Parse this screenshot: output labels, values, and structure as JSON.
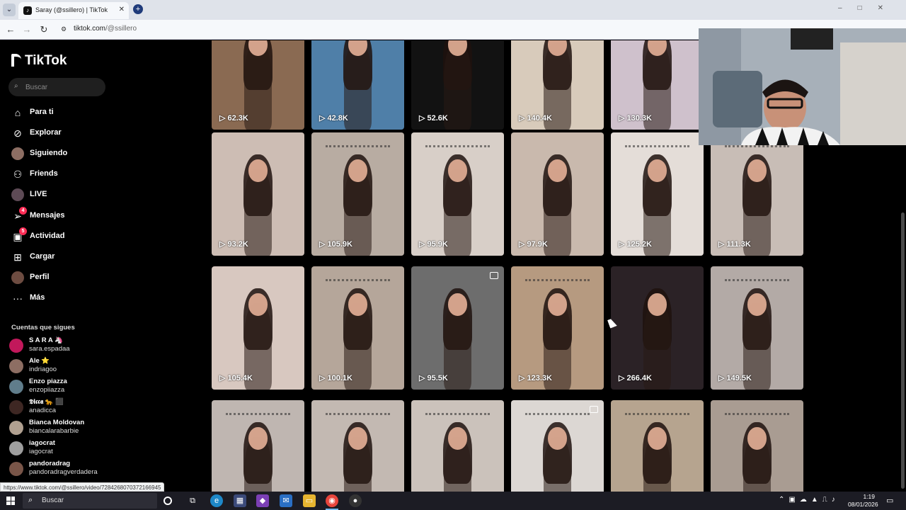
{
  "browser": {
    "tab_title": "Saray (@ssillero) | TikTok",
    "url_host": "tiktok.com",
    "url_path": "/@ssillero",
    "status_url": "https://www.tiktok.com/@ssillero/video/7284268070372166945"
  },
  "sidebar": {
    "logo": "TikTok",
    "search_placeholder": "Buscar",
    "nav": [
      {
        "label": "Para ti",
        "icon": "home-icon"
      },
      {
        "label": "Explorar",
        "icon": "compass-icon"
      },
      {
        "label": "Siguiendo",
        "icon": "avatar-icon"
      },
      {
        "label": "Friends",
        "icon": "friends-icon"
      },
      {
        "label": "LIVE",
        "icon": "live-icon"
      },
      {
        "label": "Mensajes",
        "icon": "send-icon",
        "badge": "4"
      },
      {
        "label": "Actividad",
        "icon": "inbox-icon",
        "badge": "5"
      },
      {
        "label": "Cargar",
        "icon": "upload-icon"
      },
      {
        "label": "Perfil",
        "icon": "profile-icon"
      },
      {
        "label": "Más",
        "icon": "more-icon"
      }
    ],
    "following_title": "Cuentas que sigues",
    "following": [
      {
        "name": "S A R A 🦄",
        "handle": "sara.espadaa",
        "color": "#c2185b"
      },
      {
        "name": "Ale ⭐",
        "handle": "indriagoo",
        "color": "#8d6e63"
      },
      {
        "name": "Enzo piazza",
        "handle": "enzopiiazza",
        "color": "#607d8b"
      },
      {
        "name": "𝕯𝖎𝖈𝖈𝖆 🐆 ⬛",
        "handle": "anadicca",
        "color": "#3e2723"
      },
      {
        "name": "Bianca Moldovan",
        "handle": "biancalarabarbie",
        "color": "#b0a090"
      },
      {
        "name": "iagocrat",
        "handle": "iagocrat",
        "color": "#9e9e9e"
      },
      {
        "name": "pandoradrag",
        "handle": "pandoradragverdadera",
        "color": "#795548"
      }
    ]
  },
  "videos": [
    {
      "views": "62.3K",
      "bg": "#8a6a52",
      "caption": false
    },
    {
      "views": "42.8K",
      "bg": "#4f7fa8",
      "caption": true
    },
    {
      "views": "52.6K",
      "bg": "#121212",
      "caption": true
    },
    {
      "views": "140.4K",
      "bg": "#d8cbbb",
      "caption": false
    },
    {
      "views": "130.3K",
      "bg": "#cfc1cc",
      "caption": false
    },
    {
      "views": "93.2K",
      "bg": "#cdbdb4",
      "caption": false
    },
    {
      "views": "105.9K",
      "bg": "#b8aca2",
      "caption": true
    },
    {
      "views": "95.9K",
      "bg": "#d8cfc8",
      "caption": true
    },
    {
      "views": "97.9K",
      "bg": "#c9b9ad",
      "caption": false
    },
    {
      "views": "125.2K",
      "bg": "#e4ddd8",
      "caption": true
    },
    {
      "views": "111.3K",
      "bg": "#c8bdb6",
      "caption": true
    },
    {
      "views": "105.4K",
      "bg": "#d8c8c0",
      "caption": false
    },
    {
      "views": "100.1K",
      "bg": "#b5a69a",
      "caption": true
    },
    {
      "views": "95.5K",
      "bg": "#6d6d6d",
      "caption": false
    },
    {
      "views": "123.3K",
      "bg": "#b69a80",
      "caption": true
    },
    {
      "views": "266.4K",
      "bg": "#2b2226",
      "caption": false
    },
    {
      "views": "149.5K",
      "bg": "#b3aaa6",
      "caption": true
    },
    {
      "views": "",
      "bg": "#bfb6b1",
      "caption": true
    },
    {
      "views": "",
      "bg": "#c3b9b2",
      "caption": true
    },
    {
      "views": "",
      "bg": "#cbc2bb",
      "caption": true
    },
    {
      "views": "",
      "bg": "#dcd7d3",
      "caption": true
    },
    {
      "views": "",
      "bg": "#b6a48f",
      "caption": true
    },
    {
      "views": "",
      "bg": "#a99c92",
      "caption": true
    }
  ],
  "taskbar": {
    "search": "Buscar",
    "time": "1:19",
    "date": "08/01/2026"
  }
}
